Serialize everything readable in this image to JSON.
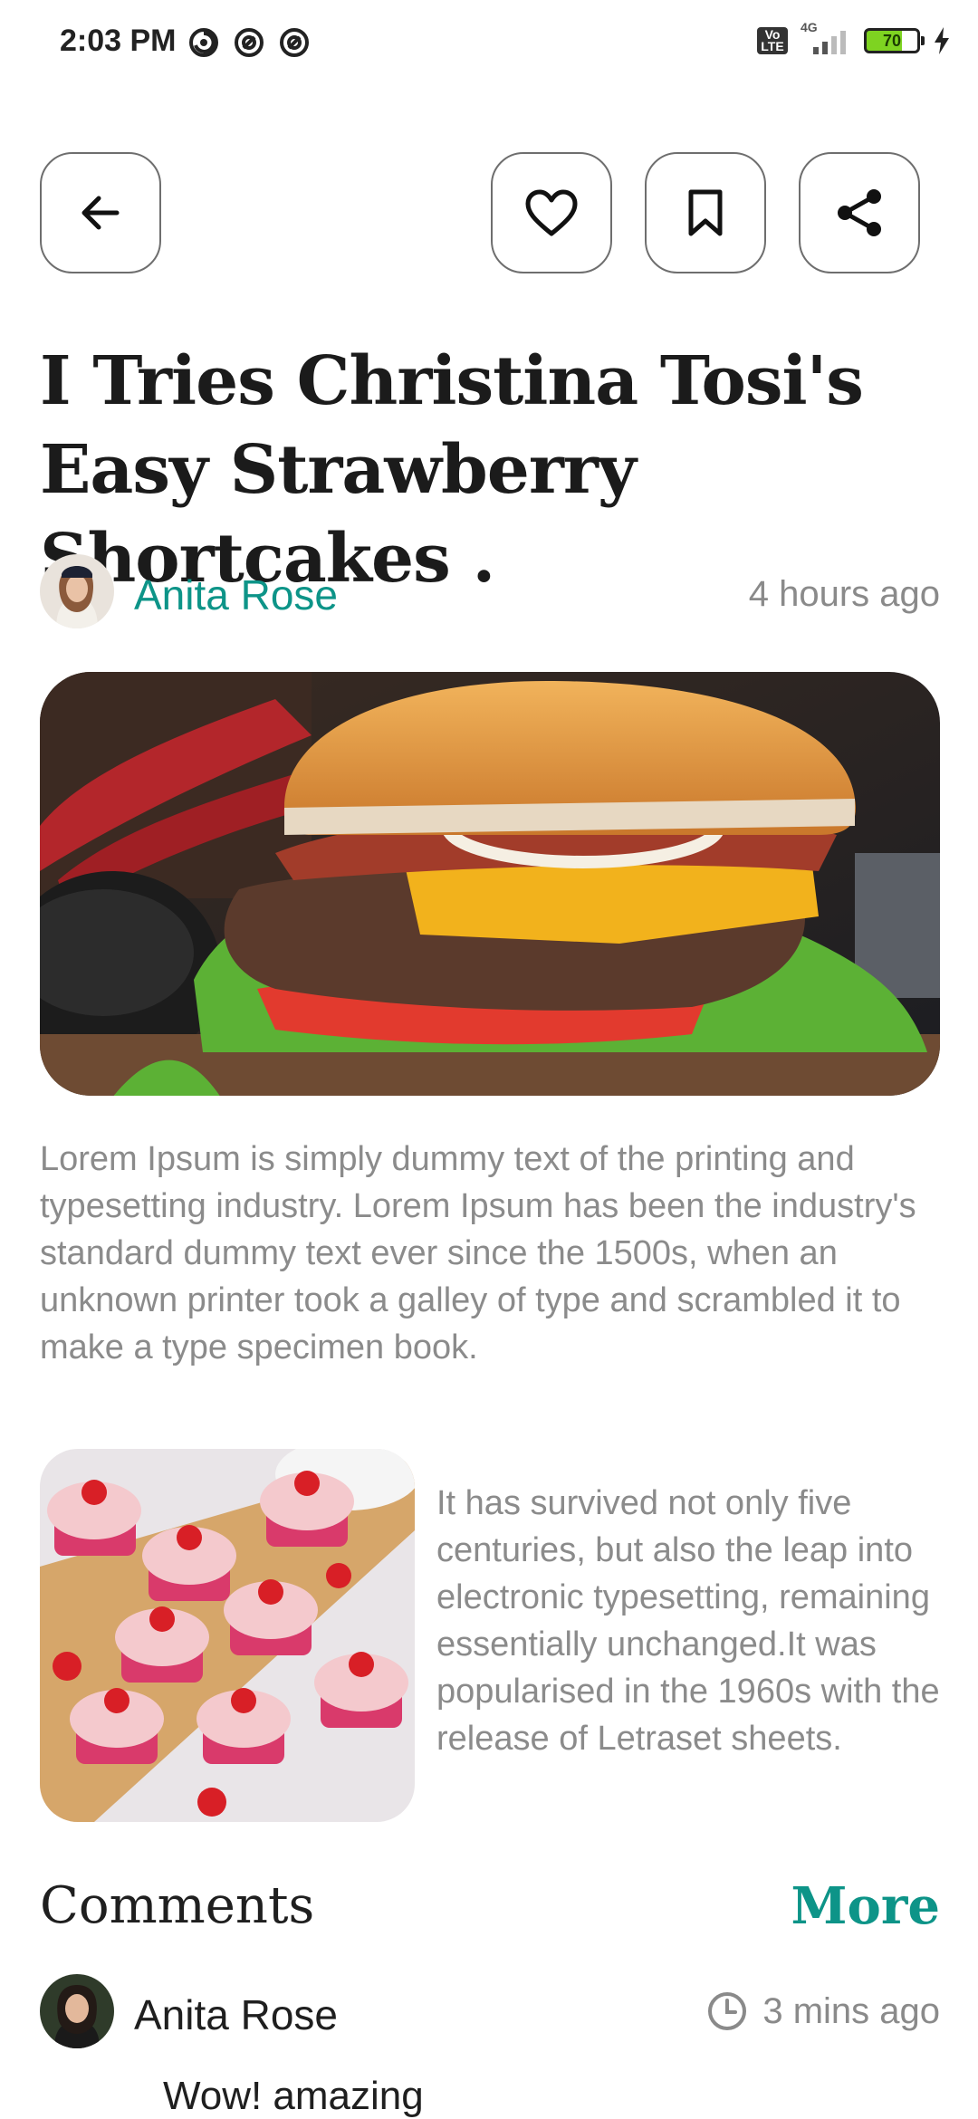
{
  "status_bar": {
    "time": "2:03 PM",
    "icons": [
      "sync-icon",
      "at-icon",
      "at-icon"
    ],
    "volte_text": "Vo LTE",
    "network": "4G",
    "battery_level": "70"
  },
  "toolbar": {
    "back_icon": "arrow-left-icon",
    "like_icon": "heart-icon",
    "bookmark_icon": "bookmark-icon",
    "share_icon": "share-icon"
  },
  "article": {
    "title": "I Tries Christina Tosi's Easy Strawberry Shortcakes .",
    "author": "Anita Rose",
    "posted": "4 hours ago",
    "paragraph1": "Lorem Ipsum is simply dummy text of the printing and typesetting industry. Lorem Ipsum has been the industry's standard dummy text ever since the 1500s, when an unknown printer took a galley of type and scrambled it to make a type specimen book.",
    "paragraph2": "It has survived not only five centuries, but also the leap into electronic typesetting, remaining essentially unchanged.It was popularised in the 1960s with the release of Letraset sheets."
  },
  "comments": {
    "heading": "Comments",
    "more_label": "More",
    "items": [
      {
        "author": "Anita Rose",
        "time": "3 mins ago",
        "text": "Wow! amazing"
      }
    ]
  },
  "colors": {
    "accent": "#0d9488",
    "muted_text": "#8b8b8b"
  }
}
